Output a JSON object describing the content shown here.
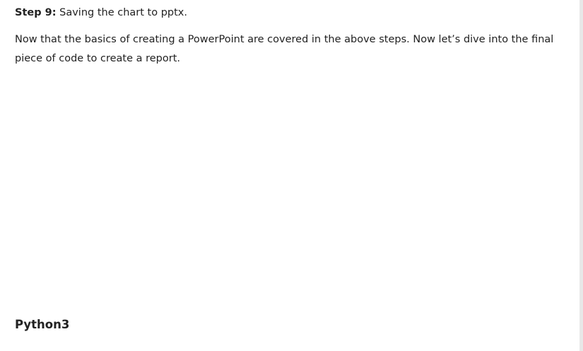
{
  "step": {
    "label": "Step 9:",
    "text": " Saving the chart to pptx."
  },
  "paragraph": "Now that the basics of creating a PowerPoint are covered in the above steps. Now let’s dive into the final piece of code to create a report.",
  "code_section": {
    "language_heading": "Python3"
  }
}
